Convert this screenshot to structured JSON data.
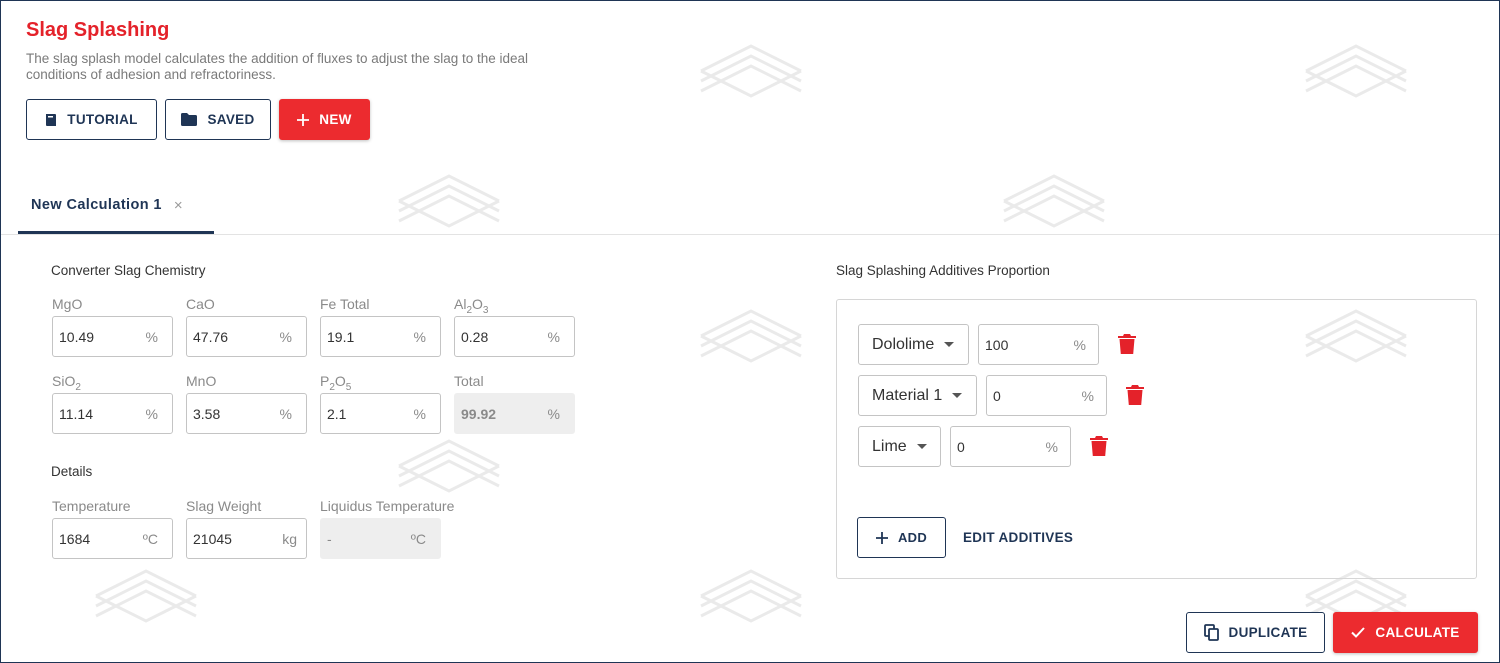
{
  "header": {
    "title": "Slag Splashing",
    "subtitle": "The slag splash model calculates the addition of fluxes to adjust the slag to the ideal conditions of adhesion and refractoriness."
  },
  "toolbar": {
    "tutorial_label": "TUTORIAL",
    "saved_label": "SAVED",
    "new_label": "NEW"
  },
  "tabs": [
    {
      "label": "New Calculation 1",
      "close": "×"
    }
  ],
  "chemistry": {
    "section_label": "Converter Slag Chemistry",
    "mgo": {
      "value": "10.49",
      "unit": "%"
    },
    "cao": {
      "label": "CaO",
      "value": "47.76",
      "unit": "%"
    },
    "fe_total": {
      "label": "Fe Total",
      "value": "19.1",
      "unit": "%"
    },
    "al2o3": {
      "value": "0.28",
      "unit": "%"
    },
    "sio2": {
      "value": "11.14",
      "unit": "%"
    },
    "mno": {
      "label": "MnO",
      "value": "3.58",
      "unit": "%"
    },
    "p2o5": {
      "value": "2.1",
      "unit": "%"
    },
    "total": {
      "label": "Total",
      "value": "99.92",
      "unit": "%"
    }
  },
  "details": {
    "section_label": "Details",
    "temperature": {
      "label": "Temperature",
      "value": "1684",
      "unit": "ºC"
    },
    "slag_weight": {
      "label": "Slag Weight",
      "value": "21045",
      "unit": "kg"
    },
    "liquidus": {
      "label": "Liquidus Temperature",
      "value": "-",
      "unit": "ºC"
    }
  },
  "additives": {
    "section_label": "Slag Splashing Additives Proportion",
    "items": [
      {
        "material": "Dololime",
        "value": "100",
        "unit": "%"
      },
      {
        "material": "Material 1",
        "value": "0",
        "unit": "%"
      },
      {
        "material": "Lime",
        "value": "0",
        "unit": "%"
      }
    ],
    "add_label": "ADD",
    "edit_label": "EDIT ADDITIVES"
  },
  "footer": {
    "duplicate_label": "DUPLICATE",
    "calculate_label": "CALCULATE"
  },
  "colors": {
    "accent_red": "#ec2b2f",
    "navy": "#1f3555"
  },
  "icons": {
    "tutorial": "book-icon",
    "saved": "folder-icon",
    "new": "plus-icon",
    "delete": "trash-icon",
    "duplicate": "copy-icon",
    "calculate": "check-icon"
  }
}
